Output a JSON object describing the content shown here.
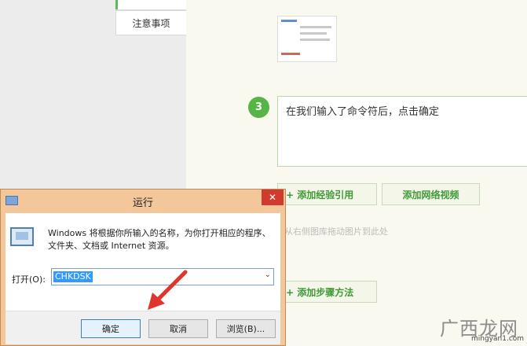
{
  "side_nav": {
    "item_label": "注意事项"
  },
  "step": {
    "number": "3",
    "text": "在我们输入了命令符后，点击确定"
  },
  "buttons": {
    "add_reference": "+ 添加经验引用",
    "add_video": "添加网络视频",
    "upload_hint": "从右侧图库拖动图片到此处",
    "add_step": "+ 添加步骤方法"
  },
  "dialog": {
    "title": "运行",
    "close": "✕",
    "description": "Windows 将根据你所输入的名称，为你打开相应的程序、文件夹、文档或 Internet 资源。",
    "open_label": "打开(O):",
    "open_value": "CHKDSK",
    "ok": "确定",
    "cancel": "取消",
    "browse": "浏览(B)..."
  },
  "watermark": {
    "logo": "广西龙网",
    "url": "mingyan1.com"
  },
  "colors": {
    "accent_green": "#55b645",
    "dialog_frame": "#f4c79b",
    "close_red": "#d13b2f"
  }
}
